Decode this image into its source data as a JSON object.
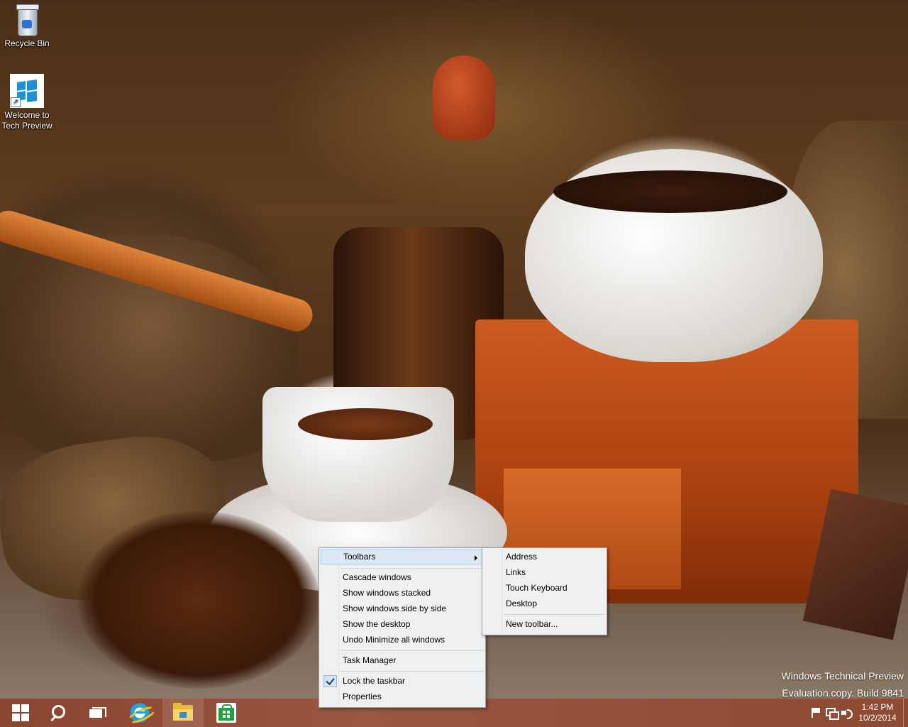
{
  "desktop": {
    "icons": [
      {
        "label_line1": "Recycle Bin",
        "label_line2": "",
        "icon": "recycle-bin-icon"
      },
      {
        "label_line1": "Welcome to",
        "label_line2": "Tech Preview",
        "icon": "windows-logo-icon"
      }
    ],
    "watermark": {
      "line1": "Windows Technical Preview",
      "line2": "Evaluation copy. Build 9841"
    }
  },
  "context_menu": {
    "items": [
      {
        "label": "Toolbars",
        "has_submenu": true,
        "highlighted": true
      },
      {
        "label": "Cascade windows"
      },
      {
        "label": "Show windows stacked"
      },
      {
        "label": "Show windows side by side"
      },
      {
        "label": "Show the desktop"
      },
      {
        "label": "Undo Minimize all windows"
      },
      {
        "label": "Task Manager"
      },
      {
        "label": "Lock the taskbar",
        "checked": true
      },
      {
        "label": "Properties"
      }
    ]
  },
  "toolbars_submenu": {
    "items": [
      {
        "label": "Address"
      },
      {
        "label": "Links"
      },
      {
        "label": "Touch Keyboard"
      },
      {
        "label": "Desktop"
      },
      {
        "label": "New toolbar..."
      }
    ]
  },
  "taskbar": {
    "buttons": [
      {
        "icon": "start-icon"
      },
      {
        "icon": "search-icon"
      },
      {
        "icon": "task-view-icon"
      },
      {
        "icon": "internet-explorer-icon"
      },
      {
        "icon": "file-explorer-icon"
      },
      {
        "icon": "store-icon"
      }
    ],
    "tray": {
      "icons": [
        "action-center-flag-icon",
        "network-icon",
        "volume-icon"
      ],
      "time": "1:42 PM",
      "date": "10/2/2014"
    }
  },
  "colors": {
    "taskbar": "#8f4c36",
    "menu_background": "#f0f0f0",
    "menu_highlight": "#dde9f5"
  }
}
